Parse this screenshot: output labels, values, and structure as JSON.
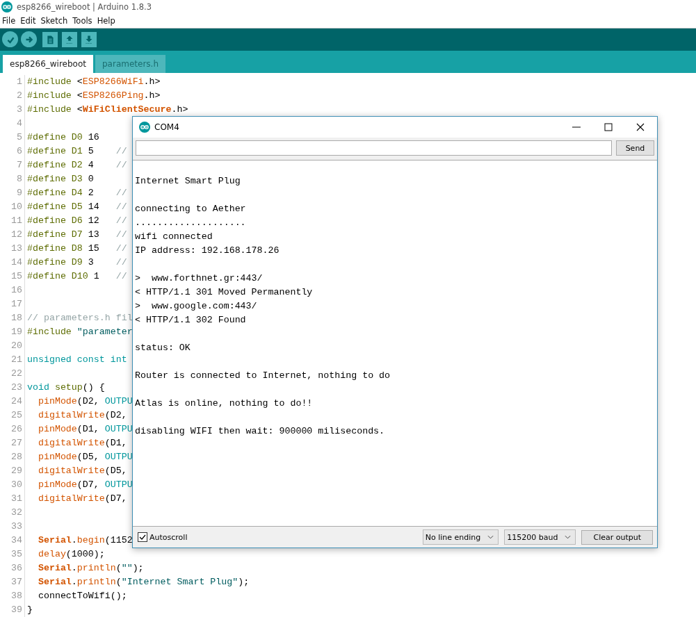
{
  "window": {
    "title": "esp8266_wireboot | Arduino 1.8.3"
  },
  "menu": [
    "File",
    "Edit",
    "Sketch",
    "Tools",
    "Help"
  ],
  "toolbar": [
    {
      "kind": "verify"
    },
    {
      "kind": "upload"
    },
    {
      "kind": "new"
    },
    {
      "kind": "open"
    },
    {
      "kind": "save"
    }
  ],
  "tabs": [
    {
      "label": "esp8266_wireboot",
      "selected": true
    },
    {
      "label": "parameters.h",
      "selected": false
    }
  ],
  "editor": {
    "lines": [
      {
        "number": "1",
        "segments": [
          {
            "kind": "keyword",
            "text": "#include"
          },
          {
            "kind": "plain",
            "text": " <"
          },
          {
            "kind": "func",
            "text": "ESP8266WiFi"
          },
          {
            "kind": "plain",
            "text": ".h>"
          }
        ]
      },
      {
        "number": "2",
        "segments": [
          {
            "kind": "keyword",
            "text": "#include"
          },
          {
            "kind": "plain",
            "text": " <"
          },
          {
            "kind": "func",
            "text": "ESP8266Ping"
          },
          {
            "kind": "plain",
            "text": ".h>"
          }
        ]
      },
      {
        "number": "3",
        "segments": [
          {
            "kind": "keyword",
            "text": "#include"
          },
          {
            "kind": "plain",
            "text": " <"
          },
          {
            "kind": "funcb",
            "text": "WiFiClientSecure"
          },
          {
            "kind": "plain",
            "text": ".h>"
          }
        ]
      },
      {
        "number": "4"
      },
      {
        "number": "5",
        "segments": [
          {
            "kind": "keyword",
            "text": "#define D0"
          },
          {
            "kind": "plain",
            "text": " 16"
          }
        ]
      },
      {
        "number": "6",
        "segments": [
          {
            "kind": "keyword",
            "text": "#define D1"
          },
          {
            "kind": "plain",
            "text": " 5    "
          },
          {
            "kind": "comment",
            "text": "//"
          }
        ]
      },
      {
        "number": "7",
        "segments": [
          {
            "kind": "keyword",
            "text": "#define D2"
          },
          {
            "kind": "plain",
            "text": " 4    "
          },
          {
            "kind": "comment",
            "text": "//"
          }
        ]
      },
      {
        "number": "8",
        "segments": [
          {
            "kind": "keyword",
            "text": "#define D3"
          },
          {
            "kind": "plain",
            "text": " 0"
          }
        ]
      },
      {
        "number": "9",
        "segments": [
          {
            "kind": "keyword",
            "text": "#define D4"
          },
          {
            "kind": "plain",
            "text": " 2    "
          },
          {
            "kind": "comment",
            "text": "//"
          }
        ]
      },
      {
        "number": "10",
        "segments": [
          {
            "kind": "keyword",
            "text": "#define D5"
          },
          {
            "kind": "plain",
            "text": " 14   "
          },
          {
            "kind": "comment",
            "text": "//"
          }
        ]
      },
      {
        "number": "11",
        "segments": [
          {
            "kind": "keyword",
            "text": "#define D6"
          },
          {
            "kind": "plain",
            "text": " 12   "
          },
          {
            "kind": "comment",
            "text": "//"
          }
        ]
      },
      {
        "number": "12",
        "segments": [
          {
            "kind": "keyword",
            "text": "#define D7"
          },
          {
            "kind": "plain",
            "text": " 13   "
          },
          {
            "kind": "comment",
            "text": "//"
          }
        ]
      },
      {
        "number": "13",
        "segments": [
          {
            "kind": "keyword",
            "text": "#define D8"
          },
          {
            "kind": "plain",
            "text": " 15   "
          },
          {
            "kind": "comment",
            "text": "//"
          }
        ]
      },
      {
        "number": "14",
        "segments": [
          {
            "kind": "keyword",
            "text": "#define D9"
          },
          {
            "kind": "plain",
            "text": " 3    "
          },
          {
            "kind": "comment",
            "text": "//"
          }
        ]
      },
      {
        "number": "15",
        "segments": [
          {
            "kind": "keyword",
            "text": "#define D10"
          },
          {
            "kind": "plain",
            "text": " 1   "
          },
          {
            "kind": "comment",
            "text": "//"
          }
        ]
      },
      {
        "number": "16"
      },
      {
        "number": "17"
      },
      {
        "number": "18",
        "segments": [
          {
            "kind": "comment",
            "text": "// parameters.h fil"
          }
        ]
      },
      {
        "number": "19",
        "segments": [
          {
            "kind": "keyword",
            "text": "#include"
          },
          {
            "kind": "string",
            "text": " \"parameter"
          }
        ]
      },
      {
        "number": "20"
      },
      {
        "number": "21",
        "segments": [
          {
            "kind": "type",
            "text": "unsigned const int"
          }
        ]
      },
      {
        "number": "22"
      },
      {
        "number": "23",
        "segments": [
          {
            "kind": "type",
            "text": "void"
          },
          {
            "kind": "keyword",
            "text": " setup"
          },
          {
            "kind": "plain",
            "text": "() {"
          }
        ]
      },
      {
        "number": "24",
        "segments": [
          {
            "kind": "func",
            "text": "  pinMode"
          },
          {
            "kind": "plain",
            "text": "(D2, "
          },
          {
            "kind": "type",
            "text": "OUTPU"
          }
        ]
      },
      {
        "number": "25",
        "segments": [
          {
            "kind": "func",
            "text": "  digitalWrite"
          },
          {
            "kind": "plain",
            "text": "(D2,"
          }
        ]
      },
      {
        "number": "26",
        "segments": [
          {
            "kind": "func",
            "text": "  pinMode"
          },
          {
            "kind": "plain",
            "text": "(D1, "
          },
          {
            "kind": "type",
            "text": "OUTPU"
          }
        ]
      },
      {
        "number": "27",
        "segments": [
          {
            "kind": "func",
            "text": "  digitalWrite"
          },
          {
            "kind": "plain",
            "text": "(D1,"
          }
        ]
      },
      {
        "number": "28",
        "segments": [
          {
            "kind": "func",
            "text": "  pinMode"
          },
          {
            "kind": "plain",
            "text": "(D5, "
          },
          {
            "kind": "type",
            "text": "OUTPU"
          }
        ]
      },
      {
        "number": "29",
        "segments": [
          {
            "kind": "func",
            "text": "  digitalWrite"
          },
          {
            "kind": "plain",
            "text": "(D5,"
          }
        ]
      },
      {
        "number": "30",
        "segments": [
          {
            "kind": "func",
            "text": "  pinMode"
          },
          {
            "kind": "plain",
            "text": "(D7, "
          },
          {
            "kind": "type",
            "text": "OUTPU"
          }
        ]
      },
      {
        "number": "31",
        "segments": [
          {
            "kind": "func",
            "text": "  digitalWrite"
          },
          {
            "kind": "plain",
            "text": "(D7,"
          }
        ]
      },
      {
        "number": "32"
      },
      {
        "number": "33"
      },
      {
        "number": "34",
        "segments": [
          {
            "kind": "funcb",
            "text": "  Serial"
          },
          {
            "kind": "plain",
            "text": "."
          },
          {
            "kind": "func",
            "text": "begin"
          },
          {
            "kind": "plain",
            "text": "(1152"
          }
        ]
      },
      {
        "number": "35",
        "segments": [
          {
            "kind": "func",
            "text": "  delay"
          },
          {
            "kind": "plain",
            "text": "(1000);"
          }
        ]
      },
      {
        "number": "36",
        "segments": [
          {
            "kind": "funcb",
            "text": "  Serial"
          },
          {
            "kind": "plain",
            "text": "."
          },
          {
            "kind": "func",
            "text": "println"
          },
          {
            "kind": "plain",
            "text": "("
          },
          {
            "kind": "string",
            "text": "\"\""
          },
          {
            "kind": "plain",
            "text": ");"
          }
        ]
      },
      {
        "number": "37",
        "segments": [
          {
            "kind": "funcb",
            "text": "  Serial"
          },
          {
            "kind": "plain",
            "text": "."
          },
          {
            "kind": "func",
            "text": "println"
          },
          {
            "kind": "plain",
            "text": "("
          },
          {
            "kind": "string",
            "text": "\"Internet Smart Plug\""
          },
          {
            "kind": "plain",
            "text": ");"
          }
        ]
      },
      {
        "number": "38",
        "segments": [
          {
            "kind": "plain",
            "text": "  connectToWifi();"
          }
        ]
      },
      {
        "number": "39",
        "segments": [
          {
            "kind": "plain",
            "text": "}"
          }
        ]
      }
    ]
  },
  "serial_monitor": {
    "title": "COM4",
    "send_label": "Send",
    "output": [
      {
        "kind": "blank"
      },
      {
        "kind": "text",
        "text": "Internet Smart Plug"
      },
      {
        "kind": "blank"
      },
      {
        "kind": "text",
        "text": "connecting to Aether"
      },
      {
        "kind": "text",
        "text": "...................."
      },
      {
        "kind": "text",
        "text": "wifi connected"
      },
      {
        "kind": "text",
        "text": "IP address: 192.168.178.26"
      },
      {
        "kind": "blank"
      },
      {
        "kind": "text",
        "text": ">  www.forthnet.gr:443/"
      },
      {
        "kind": "text",
        "text": "< HTTP/1.1 301 Moved Permanently"
      },
      {
        "kind": "text",
        "text": ">  www.google.com:443/"
      },
      {
        "kind": "text",
        "text": "< HTTP/1.1 302 Found"
      },
      {
        "kind": "blank"
      },
      {
        "kind": "text",
        "text": "status: OK"
      },
      {
        "kind": "blank"
      },
      {
        "kind": "text",
        "text": "Router is connected to Internet, nothing to do"
      },
      {
        "kind": "blank"
      },
      {
        "kind": "text",
        "text": "Atlas is online, nothing to do!!"
      },
      {
        "kind": "blank"
      },
      {
        "kind": "text",
        "text": "disabling WIFI then wait: 900000 miliseconds."
      }
    ],
    "autoscroll": {
      "label": "Autoscroll",
      "checked": true
    },
    "line_ending": "No line ending",
    "baud": "115200 baud",
    "clear_label": "Clear output"
  }
}
